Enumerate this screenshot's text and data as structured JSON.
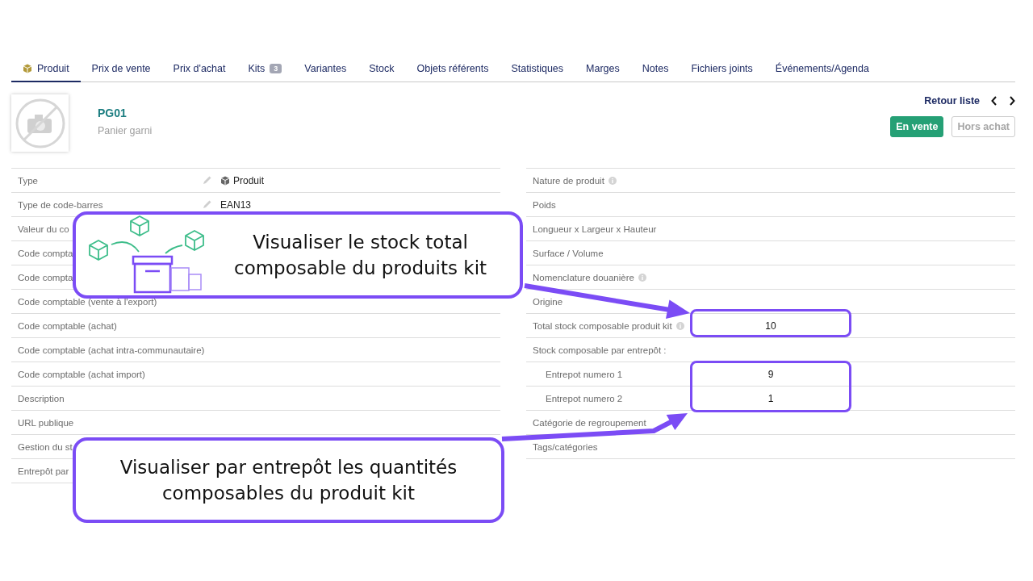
{
  "tabs": [
    {
      "label": "Produit",
      "selected": true,
      "kind": "product"
    },
    {
      "label": "Prix de vente",
      "selected": false
    },
    {
      "label": "Prix d'achat",
      "selected": false
    },
    {
      "label": "Kits",
      "selected": false,
      "badge": "3"
    },
    {
      "label": "Variantes",
      "selected": false
    },
    {
      "label": "Stock",
      "selected": false
    },
    {
      "label": "Objets référents",
      "selected": false
    },
    {
      "label": "Statistiques",
      "selected": false
    },
    {
      "label": "Marges",
      "selected": false
    },
    {
      "label": "Notes",
      "selected": false
    },
    {
      "label": "Fichiers joints",
      "selected": false
    },
    {
      "label": "Événements/Agenda",
      "selected": false
    }
  ],
  "product": {
    "ref": "PG01",
    "label": "Panier garni"
  },
  "nav": {
    "back": "Retour liste"
  },
  "status_buttons": [
    {
      "label": "En vente",
      "on": true
    },
    {
      "label": "Hors achat",
      "on": false
    }
  ],
  "left_fields": [
    {
      "label": "Type",
      "editable": true,
      "value": "Produit",
      "kind": "product_type"
    },
    {
      "label": "Type de code-barres",
      "editable": true,
      "value": "EAN13"
    },
    {
      "label": "Valeur du co",
      "editable": false
    },
    {
      "label": "Code compta",
      "editable": false
    },
    {
      "label": "Code compta",
      "editable": false
    },
    {
      "label": "Code comptable (vente à l'export)",
      "editable": false
    },
    {
      "label": "Code comptable (achat)",
      "editable": false
    },
    {
      "label": "Code comptable (achat intra-communautaire)",
      "editable": false
    },
    {
      "label": "Code comptable (achat import)",
      "editable": false
    },
    {
      "label": "Description",
      "editable": false
    },
    {
      "label": "URL publique",
      "editable": false
    },
    {
      "label": "Gestion du st",
      "editable": false
    },
    {
      "label": "Entrepôt par",
      "editable": false
    }
  ],
  "right_fields": [
    {
      "label": "Nature de produit",
      "info": true
    },
    {
      "label": "Poids",
      "info": false
    },
    {
      "label": "Longueur x Largeur x Hauteur",
      "info": false
    },
    {
      "label": "Surface / Volume",
      "info": false
    },
    {
      "label": "Nomenclature douanière",
      "info": true
    },
    {
      "label": "Origine",
      "info": false
    },
    {
      "label": "Total stock composable produit kit",
      "info": true,
      "value": "10",
      "highlighted": true
    },
    {
      "label": "Stock composable par entrepôt :",
      "info": false,
      "children_highlighted": true,
      "children": [
        {
          "label": "Entrepot numero 1",
          "value": "9"
        },
        {
          "label": "Entrepot numero 2",
          "value": "1"
        }
      ]
    },
    {
      "label": "Catégorie de regroupement",
      "info": false
    },
    {
      "label": "Tags/catégories",
      "info": false
    }
  ],
  "callouts": [
    {
      "text": "Visualiser le stock total\ncomposable du produits kit",
      "kind": "illustrated"
    },
    {
      "text": "Visualiser par entrepôt les quantités\ncomposables du produit kit",
      "kind": "plain"
    }
  ]
}
